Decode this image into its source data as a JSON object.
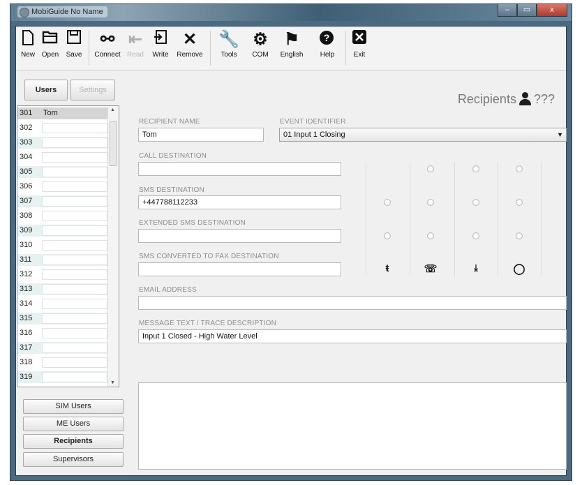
{
  "window": {
    "title": "MobiGuide No Name",
    "min": "–",
    "max": "▭",
    "close": "x"
  },
  "toolbar": {
    "new": "New",
    "open": "Open",
    "save": "Save",
    "connect": "Connect",
    "read": "Read",
    "write": "Write",
    "remove": "Remove",
    "tools": "Tools",
    "com": "COM",
    "english": "English",
    "help": "Help",
    "exit": "Exit"
  },
  "tabs": {
    "users": "Users",
    "settings": "Settings"
  },
  "header": {
    "title": "Recipients",
    "count": "???"
  },
  "user_list": [
    {
      "num": "301",
      "name": "Tom"
    },
    {
      "num": "302",
      "name": ""
    },
    {
      "num": "303",
      "name": ""
    },
    {
      "num": "304",
      "name": ""
    },
    {
      "num": "305",
      "name": ""
    },
    {
      "num": "306",
      "name": ""
    },
    {
      "num": "307",
      "name": ""
    },
    {
      "num": "308",
      "name": ""
    },
    {
      "num": "309",
      "name": ""
    },
    {
      "num": "310",
      "name": ""
    },
    {
      "num": "311",
      "name": ""
    },
    {
      "num": "312",
      "name": ""
    },
    {
      "num": "313",
      "name": ""
    },
    {
      "num": "314",
      "name": ""
    },
    {
      "num": "315",
      "name": ""
    },
    {
      "num": "316",
      "name": ""
    },
    {
      "num": "317",
      "name": ""
    },
    {
      "num": "318",
      "name": ""
    },
    {
      "num": "319",
      "name": ""
    }
  ],
  "nav_buttons": {
    "sim_users": "SIM Users",
    "me_users": "ME Users",
    "recipients": "Recipients",
    "supervisors": "Supervisors"
  },
  "form": {
    "recipient_name_label": "RECIPIENT NAME",
    "recipient_name": "Tom",
    "event_identifier_label": "EVENT IDENTIFIER",
    "event_identifier": "01 Input 1 Closing",
    "call_destination_label": "CALL DESTINATION",
    "call_destination": "",
    "sms_destination_label": "SMS DESTINATION",
    "sms_destination": "+447788112233",
    "extended_sms_label": "EXTENDED SMS DESTINATION",
    "extended_sms": "",
    "sms_fax_label": "SMS CONVERTED TO FAX DESTINATION",
    "sms_fax": "",
    "email_label": "EMAIL ADDRESS",
    "email": "",
    "message_label": "MESSAGE TEXT / TRACE DESCRIPTION",
    "message": "Input 1 Closed - High Water Level"
  },
  "icons": {
    "new": "new-file-icon",
    "open": "folder-open-icon",
    "save": "floppy-save-icon",
    "connect": "connect-icon",
    "read": "read-icon",
    "write": "write-icon",
    "remove": "remove-icon",
    "tools": "wrench-icon",
    "com": "gear-icon",
    "english": "flag-icon",
    "help": "help-icon",
    "exit": "exit-icon",
    "col1": "sms-icon",
    "col2": "phone-icon",
    "col3": "download-icon",
    "col4": "chat-bubble-icon"
  }
}
